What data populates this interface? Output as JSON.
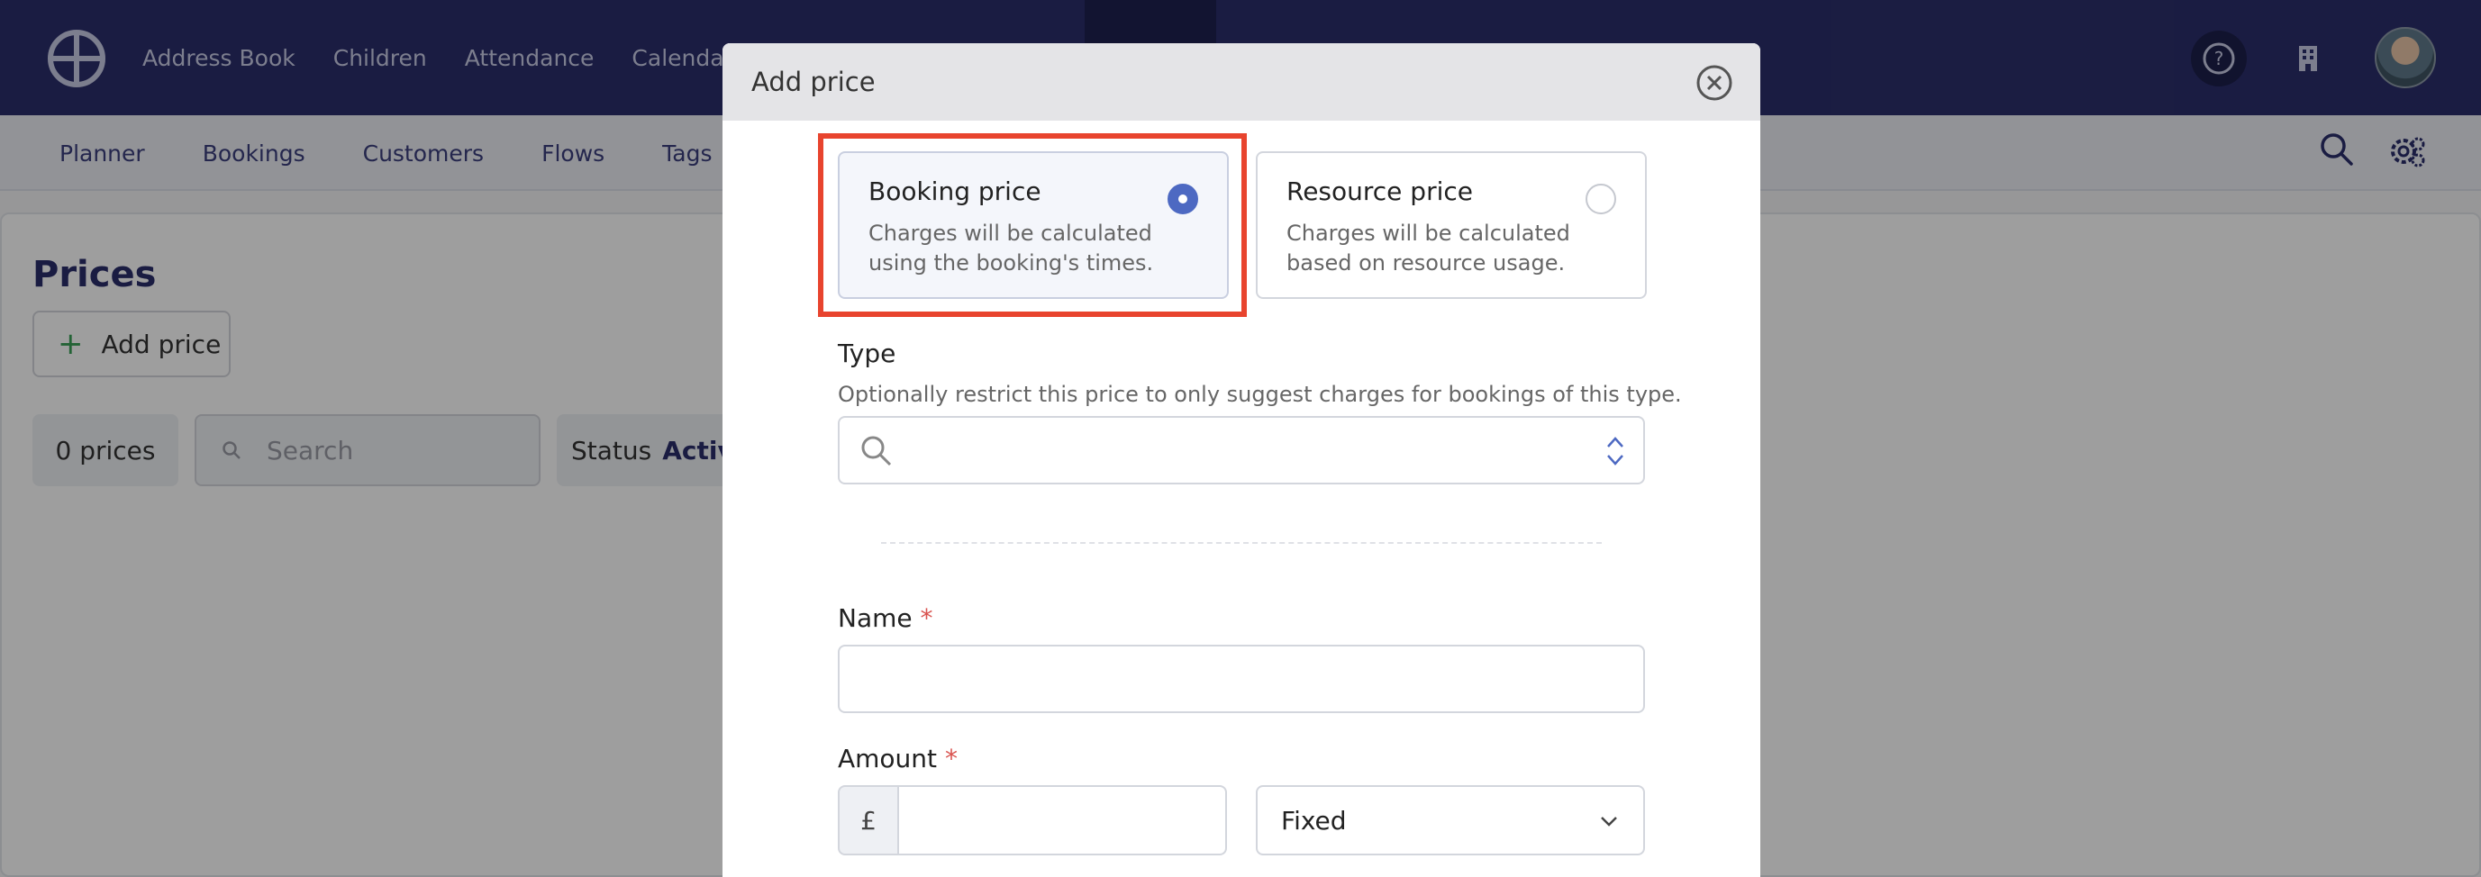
{
  "topnav": {
    "items": [
      "Address Book",
      "Children",
      "Attendance",
      "Calendar"
    ]
  },
  "subnav": {
    "items": [
      "Planner",
      "Bookings",
      "Customers",
      "Flows",
      "Tags"
    ]
  },
  "page": {
    "title": "Prices",
    "add_button": "Add price",
    "count": "0 prices",
    "search_placeholder": "Search",
    "status_label": "Status",
    "status_value": "Active"
  },
  "modal": {
    "title": "Add price",
    "options": [
      {
        "title": "Booking price",
        "desc": "Charges will be calculated using the booking's times.",
        "selected": true
      },
      {
        "title": "Resource price",
        "desc": "Charges will be calculated based on resource usage.",
        "selected": false
      }
    ],
    "type_label": "Type",
    "type_help": "Optionally restrict this price to only suggest charges for bookings of this type.",
    "name_label": "Name",
    "amount_label": "Amount",
    "required_mark": "*",
    "currency_symbol": "£",
    "amount_mode": "Fixed"
  },
  "colors": {
    "topbar": "#2b2e6b",
    "accent": "#4d69c2",
    "highlight": "#e8442e",
    "required": "#d9534f"
  }
}
